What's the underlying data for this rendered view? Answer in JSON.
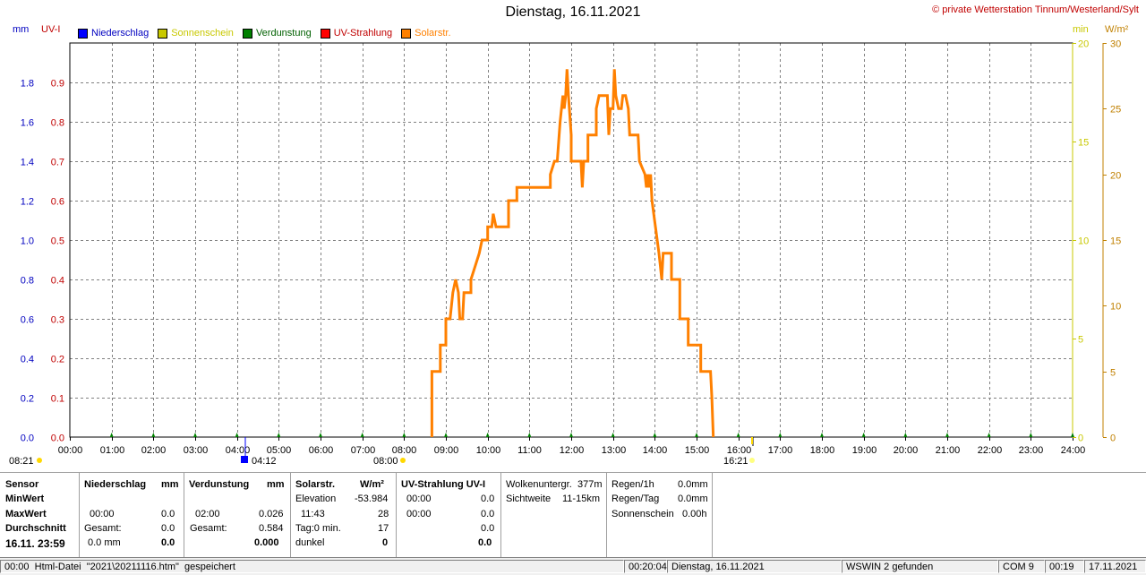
{
  "header": {
    "title": "Dienstag, 16.11.2021",
    "copyright": "© private Wetterstation Tinnum/Westerland/Sylt"
  },
  "units": {
    "mm": "mm",
    "uvi": "UV-I",
    "min": "min",
    "wm2": "W/m²"
  },
  "legend": [
    {
      "label": "Niederschlag",
      "color": "#0000ff"
    },
    {
      "label": "Sonnenschein",
      "color": "#c8c800"
    },
    {
      "label": "Verdunstung",
      "color": "#008000"
    },
    {
      "label": "UV-Strahlung",
      "color": "#ff0000"
    },
    {
      "label": "Solarstr.",
      "color": "#ff8000"
    }
  ],
  "colors": {
    "mm_axis": "#0000c0",
    "uvi_axis": "#c00000",
    "min_axis": "#c8c800",
    "wm2_axis": "#c08000",
    "solar": "#ff8000",
    "evap_marker": "#008000"
  },
  "chart_data": {
    "type": "line",
    "title": "Dienstag, 16.11.2021",
    "x_range": [
      "00:00",
      "24:00"
    ],
    "x_ticks": [
      "00:00",
      "01:00",
      "02:00",
      "03:00",
      "04:00",
      "05:00",
      "06:00",
      "07:00",
      "08:00",
      "09:00",
      "10:00",
      "11:00",
      "12:00",
      "13:00",
      "14:00",
      "15:00",
      "16:00",
      "17:00",
      "18:00",
      "19:00",
      "20:00",
      "21:00",
      "22:00",
      "23:00",
      "24:00"
    ],
    "y_axes": {
      "mm": {
        "ticks": [
          "0.0",
          "0.2",
          "0.4",
          "0.6",
          "0.8",
          "1.0",
          "1.2",
          "1.4",
          "1.6",
          "1.8"
        ],
        "range": [
          0,
          2.0
        ]
      },
      "uvi": {
        "ticks": [
          "0.0",
          "0.1",
          "0.2",
          "0.3",
          "0.4",
          "0.5",
          "0.6",
          "0.7",
          "0.8",
          "0.9"
        ],
        "range": [
          0,
          1.0
        ]
      },
      "min": {
        "ticks": [
          "0",
          "5",
          "10",
          "15",
          "20"
        ],
        "range": [
          0,
          20
        ]
      },
      "wm2": {
        "ticks": [
          "0",
          "5",
          "10",
          "15",
          "20",
          "25",
          "30"
        ],
        "range": [
          0,
          30
        ]
      }
    },
    "grid": true,
    "series": [
      {
        "name": "Solarstr.",
        "unit": "W/m²",
        "points": [
          [
            "08:40",
            0
          ],
          [
            "08:40",
            5
          ],
          [
            "08:52",
            5
          ],
          [
            "08:52",
            7
          ],
          [
            "09:00",
            7
          ],
          [
            "09:00",
            9
          ],
          [
            "09:06",
            9
          ],
          [
            "09:10",
            11
          ],
          [
            "09:14",
            12
          ],
          [
            "09:18",
            11
          ],
          [
            "09:20",
            9
          ],
          [
            "09:24",
            9
          ],
          [
            "09:26",
            11
          ],
          [
            "09:36",
            11
          ],
          [
            "09:36",
            12
          ],
          [
            "09:42",
            13
          ],
          [
            "09:48",
            14
          ],
          [
            "09:52",
            15
          ],
          [
            "10:00",
            15
          ],
          [
            "10:00",
            16
          ],
          [
            "10:06",
            16
          ],
          [
            "10:08",
            17
          ],
          [
            "10:12",
            16
          ],
          [
            "10:30",
            16
          ],
          [
            "10:30",
            18
          ],
          [
            "10:42",
            18
          ],
          [
            "10:42",
            19
          ],
          [
            "11:30",
            19
          ],
          [
            "11:30",
            20
          ],
          [
            "11:36",
            21
          ],
          [
            "11:40",
            21
          ],
          [
            "11:44",
            24
          ],
          [
            "11:48",
            26
          ],
          [
            "11:50",
            25
          ],
          [
            "11:52",
            26
          ],
          [
            "11:54",
            28
          ],
          [
            "11:56",
            26
          ],
          [
            "12:00",
            23
          ],
          [
            "12:00",
            21
          ],
          [
            "12:14",
            21
          ],
          [
            "12:16",
            19
          ],
          [
            "12:18",
            21
          ],
          [
            "12:24",
            21
          ],
          [
            "12:24",
            23
          ],
          [
            "12:36",
            23
          ],
          [
            "12:36",
            25
          ],
          [
            "12:40",
            26
          ],
          [
            "12:52",
            26
          ],
          [
            "12:54",
            23
          ],
          [
            "12:56",
            25
          ],
          [
            "13:00",
            25
          ],
          [
            "13:02",
            28
          ],
          [
            "13:04",
            26
          ],
          [
            "13:08",
            25
          ],
          [
            "13:12",
            25
          ],
          [
            "13:14",
            26
          ],
          [
            "13:18",
            26
          ],
          [
            "13:22",
            25
          ],
          [
            "13:24",
            23
          ],
          [
            "13:36",
            23
          ],
          [
            "13:38",
            21
          ],
          [
            "13:46",
            20
          ],
          [
            "13:48",
            19
          ],
          [
            "13:50",
            20
          ],
          [
            "13:52",
            19
          ],
          [
            "13:54",
            20
          ],
          [
            "13:56",
            18
          ],
          [
            "14:06",
            14
          ],
          [
            "14:08",
            13
          ],
          [
            "14:10",
            12
          ],
          [
            "14:12",
            14
          ],
          [
            "14:24",
            14
          ],
          [
            "14:24",
            12
          ],
          [
            "14:36",
            12
          ],
          [
            "14:36",
            9
          ],
          [
            "14:48",
            9
          ],
          [
            "14:48",
            7
          ],
          [
            "15:06",
            7
          ],
          [
            "15:06",
            5
          ],
          [
            "15:20",
            5
          ],
          [
            "15:22",
            3
          ],
          [
            "15:24",
            0
          ]
        ]
      }
    ],
    "evaporation_markers": [
      "01:00",
      "02:00",
      "03:00",
      "04:00",
      "05:00",
      "06:00",
      "07:00",
      "08:00",
      "09:00",
      "10:00",
      "11:00",
      "12:00",
      "13:00",
      "14:00",
      "15:00",
      "16:00",
      "17:00",
      "18:00",
      "19:00",
      "20:00",
      "21:00",
      "22:00",
      "23:00",
      "24:00"
    ],
    "annotations": {
      "sunrise": "08:21",
      "sun_start": "08:00",
      "moon": "04:12",
      "sunset": "16:21"
    }
  },
  "table": {
    "sensor": {
      "header": "Sensor",
      "minwert": "MinWert",
      "maxwert": "MaxWert",
      "durchschnitt": "Durchschnitt",
      "date": "16.11. 23:59"
    },
    "niederschlag": {
      "header": "Niederschlag",
      "unit": "mm",
      "max_time": "00:00",
      "max_val": "0.0",
      "gesamt_label": "Gesamt:",
      "gesamt_val": "0.0",
      "avg_label": "0.0 mm",
      "avg_val": "0.0"
    },
    "verdunstung": {
      "header": "Verdunstung",
      "unit": "mm",
      "max_time": "02:00",
      "max_val": "0.026",
      "gesamt_label": "Gesamt:",
      "gesamt_val": "0.584",
      "avg_val": "0.000"
    },
    "solar": {
      "header": "Solarstr.",
      "unit": "W/m²",
      "elev_label": "Elevation",
      "elev_val": "-53.984",
      "max_time": "11:43",
      "max_val": "28",
      "tag_label": "Tag:0 min.",
      "tag_val": "17",
      "dunkel_label": "dunkel",
      "dunkel_val": "0"
    },
    "uv": {
      "header": "UV-Strahlung UV-I",
      "t1": "00:00",
      "v1": "0.0",
      "t2": "00:00",
      "v2": "0.0",
      "v3": "0.0",
      "v4": "0.0"
    },
    "cloud": {
      "label1": "Wolkenuntergr.",
      "val1": "377m",
      "label2": "Sichtweite",
      "val2": "11-15km"
    },
    "rain": {
      "label1": "Regen/1h",
      "val1": "0.0mm",
      "label2": "Regen/Tag",
      "val2": "0.0mm",
      "label3": "Sonnenschein",
      "val3": "0.00h"
    }
  },
  "statusbar": {
    "left": "00:00  Html-Datei  \"2021\\20211116.htm\"  gespeichert",
    "time": "00:20:04",
    "date": "Dienstag, 16.11.2021",
    "wswin": "WSWIN 2 gefunden",
    "com": "COM 9",
    "clock": "00:19",
    "date2": "17.11.2021"
  }
}
